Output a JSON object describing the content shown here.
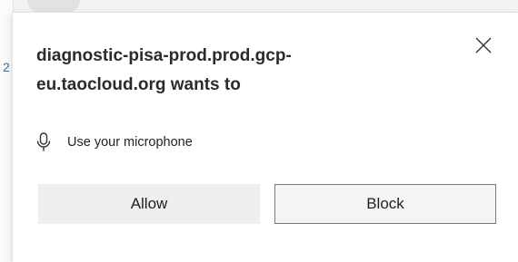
{
  "background": {
    "glimpse_char": "2"
  },
  "popup": {
    "site_line1": "diagnostic-pisa-prod.prod.gcp-",
    "site_line2": "eu.taocloud.org wants to",
    "permission": {
      "icon": "microphone-icon",
      "label": "Use your microphone"
    },
    "close_icon": "close-icon",
    "allow_label": "Allow",
    "block_label": "Block"
  },
  "colors": {
    "allow_bg": "#efefef",
    "block_border": "#7a7a7a",
    "text": "#2b2b2b"
  }
}
